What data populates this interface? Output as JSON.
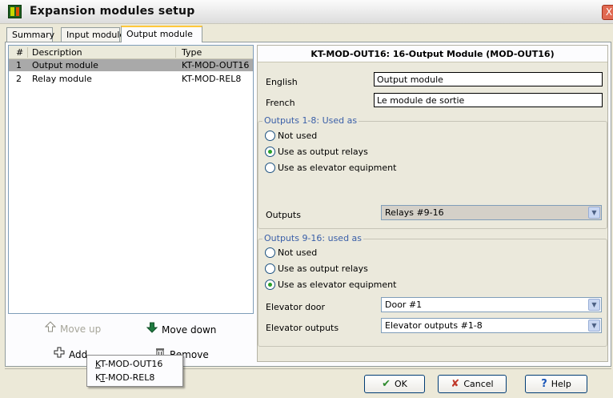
{
  "window": {
    "title": "Expansion modules setup",
    "close_glyph": "X"
  },
  "tabs": [
    {
      "label": "Summary"
    },
    {
      "label": "Input module"
    },
    {
      "label": "Output module",
      "active": true
    }
  ],
  "list": {
    "headers": {
      "num": "#",
      "description": "Description",
      "type": "Type"
    },
    "rows": [
      {
        "num": "1",
        "description": "Output module",
        "type": "KT-MOD-OUT16",
        "selected": true
      },
      {
        "num": "2",
        "description": "Relay module",
        "type": "KT-MOD-REL8",
        "selected": false
      }
    ]
  },
  "left_buttons": {
    "move_up": "Move up",
    "move_down": "Move down",
    "add": "Add",
    "remove": "Remove"
  },
  "module": {
    "heading": "KT-MOD-OUT16: 16-Output Module (MOD-OUT16)",
    "english_label": "English",
    "english_value": "Output module",
    "french_label": "French",
    "french_value": "Le module de sortie"
  },
  "group1": {
    "title": "Outputs 1-8: Used as",
    "options": [
      "Not used",
      "Use as output relays",
      "Use as elevator equipment"
    ],
    "selected": 1,
    "outputs_label": "Outputs",
    "outputs_value": "Relays #9-16"
  },
  "group2": {
    "title": "Outputs 9-16: used as",
    "options": [
      "Not used",
      "Use as output relays",
      "Use as elevator equipment"
    ],
    "selected": 2,
    "door_label": "Elevator door",
    "door_value": "Door #1",
    "elev_outputs_label": "Elevator outputs",
    "elev_outputs_value": "Elevator outputs #1-8"
  },
  "popup_menu": {
    "items": [
      {
        "prefix": "K",
        "rest": "T-MOD-OUT16"
      },
      {
        "prefix": "K",
        "u": "T",
        "rest": "-MOD-REL8"
      }
    ]
  },
  "footer": {
    "ok": "OK",
    "cancel": "Cancel",
    "help": "Help"
  },
  "colors": {
    "selected_row": "#a9a9a9",
    "group_title": "#3a5fa8",
    "tab_accent": "#ffc83c"
  },
  "icons": {
    "app": "app-module-icon",
    "move_up": "arrow-up-outline-icon",
    "move_down": "arrow-down-icon",
    "add": "plus-outline-icon",
    "remove": "trash-icon",
    "ok": "checkmark-icon",
    "cancel": "x-icon",
    "help": "question-icon"
  }
}
